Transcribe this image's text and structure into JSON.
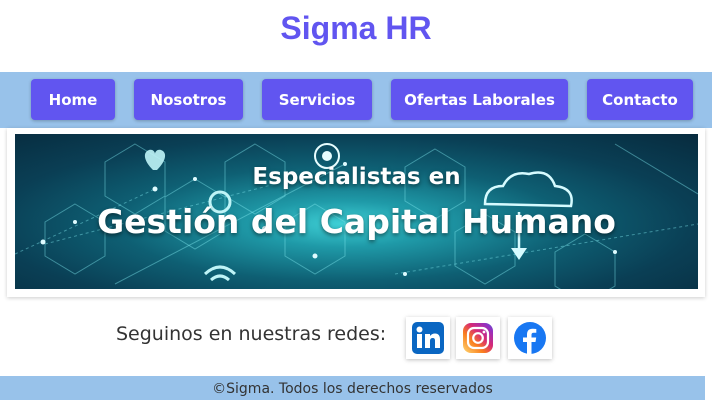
{
  "header": {
    "title": "Sigma HR"
  },
  "nav": {
    "items": [
      {
        "label": "Home"
      },
      {
        "label": "Nosotros"
      },
      {
        "label": "Servicios"
      },
      {
        "label": "Ofertas Laborales"
      },
      {
        "label": "Contacto"
      }
    ]
  },
  "banner": {
    "line1": "Especialistas en",
    "line2": "Gestión del Capital Humano"
  },
  "social": {
    "label": "Seguinos en nuestras redes:",
    "icons": [
      "linkedin-icon",
      "instagram-icon",
      "facebook-icon"
    ]
  },
  "footer": {
    "text": "©Sigma. Todos los derechos reservados"
  },
  "colors": {
    "accent": "#6155f0",
    "bar": "#98c2ea"
  }
}
